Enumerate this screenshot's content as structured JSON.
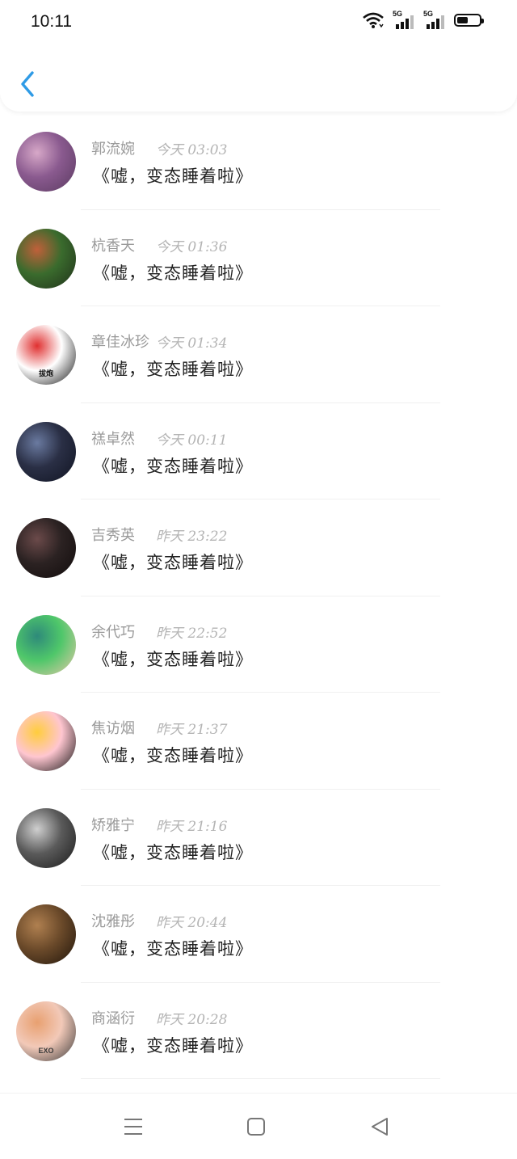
{
  "status_bar": {
    "time": "10:11",
    "network_1": "5G",
    "network_2": "5G",
    "battery_level": 0.5,
    "icons": [
      "wifi-icon",
      "signal-icon",
      "signal-icon",
      "battery-icon"
    ]
  },
  "header": {
    "back_icon": "chevron-left-icon",
    "accent_color": "#2f9be6"
  },
  "list": [
    {
      "name": "郭流婉",
      "time": "今天 03:03",
      "message": "《嘘，变态睡着啦》",
      "avatar_colors": [
        "#8a5a8f",
        "#d7a8c8",
        "#5a3a60"
      ]
    },
    {
      "name": "杭香天",
      "time": "今天 01:36",
      "message": "《嘘，变态睡着啦》",
      "avatar_colors": [
        "#3a6b2d",
        "#c0603a",
        "#20301a"
      ]
    },
    {
      "name": "章佳冰珍",
      "time": "今天 01:34",
      "message": "《嘘，变态睡着啦》",
      "avatar_colors": [
        "#ffffff",
        "#e03030",
        "#111111"
      ],
      "avatar_caption": "拔炮"
    },
    {
      "name": "禚卓然",
      "time": "今天 00:11",
      "message": "《嘘，变态睡着啦》",
      "avatar_colors": [
        "#2a2f45",
        "#6a7aa0",
        "#101422"
      ]
    },
    {
      "name": "吉秀英",
      "time": "昨天 23:22",
      "message": "《嘘，变态睡着啦》",
      "avatar_colors": [
        "#2b2222",
        "#6b4a4a",
        "#120c0c"
      ]
    },
    {
      "name": "余代巧",
      "time": "昨天 22:52",
      "message": "《嘘，变态睡着啦》",
      "avatar_colors": [
        "#4fc76a",
        "#2e8a7a",
        "#e8c9a8"
      ]
    },
    {
      "name": "焦访烟",
      "time": "昨天 21:37",
      "message": "《嘘，变态睡着啦》",
      "avatar_colors": [
        "#ffc6d0",
        "#ffcd3c",
        "#111111"
      ]
    },
    {
      "name": "矫雅宁",
      "time": "昨天 21:16",
      "message": "《嘘，变态睡着啦》",
      "avatar_colors": [
        "#5a5a5a",
        "#cfcfcf",
        "#1a1a1a"
      ]
    },
    {
      "name": "沈雅彤",
      "time": "昨天 20:44",
      "message": "《嘘，变态睡着啦》",
      "avatar_colors": [
        "#6b4a2a",
        "#b08050",
        "#1f140a"
      ]
    },
    {
      "name": "商涵衍",
      "time": "昨天 20:28",
      "message": "《嘘，变态睡着啦》",
      "avatar_colors": [
        "#f2c9b8",
        "#e8a070",
        "#3a3a3a"
      ],
      "avatar_caption": "EXO"
    }
  ],
  "navbar": {
    "icons": [
      "menu-icon",
      "home-square-icon",
      "back-triangle-icon"
    ]
  }
}
